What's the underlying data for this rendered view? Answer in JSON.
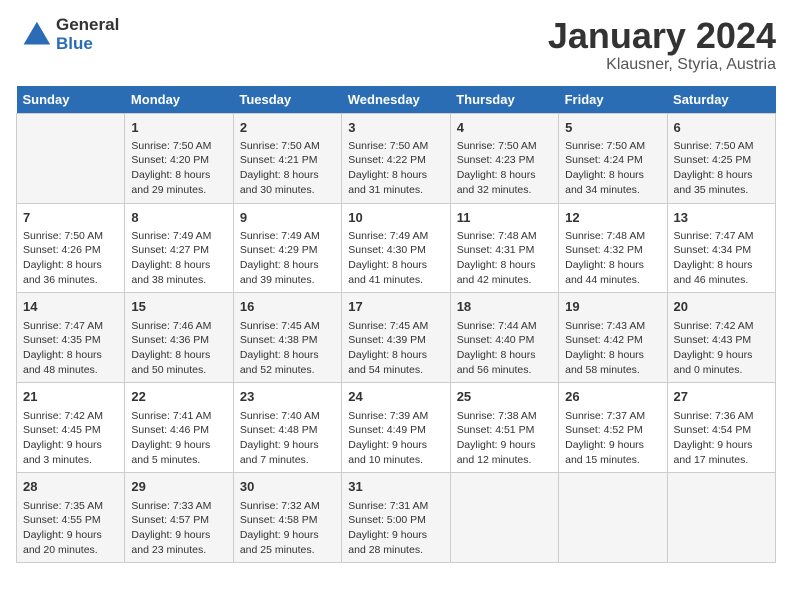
{
  "header": {
    "logo_general": "General",
    "logo_blue": "Blue",
    "month": "January 2024",
    "location": "Klausner, Styria, Austria"
  },
  "days_of_week": [
    "Sunday",
    "Monday",
    "Tuesday",
    "Wednesday",
    "Thursday",
    "Friday",
    "Saturday"
  ],
  "weeks": [
    [
      {
        "day": "",
        "info": ""
      },
      {
        "day": "1",
        "info": "Sunrise: 7:50 AM\nSunset: 4:20 PM\nDaylight: 8 hours\nand 29 minutes."
      },
      {
        "day": "2",
        "info": "Sunrise: 7:50 AM\nSunset: 4:21 PM\nDaylight: 8 hours\nand 30 minutes."
      },
      {
        "day": "3",
        "info": "Sunrise: 7:50 AM\nSunset: 4:22 PM\nDaylight: 8 hours\nand 31 minutes."
      },
      {
        "day": "4",
        "info": "Sunrise: 7:50 AM\nSunset: 4:23 PM\nDaylight: 8 hours\nand 32 minutes."
      },
      {
        "day": "5",
        "info": "Sunrise: 7:50 AM\nSunset: 4:24 PM\nDaylight: 8 hours\nand 34 minutes."
      },
      {
        "day": "6",
        "info": "Sunrise: 7:50 AM\nSunset: 4:25 PM\nDaylight: 8 hours\nand 35 minutes."
      }
    ],
    [
      {
        "day": "7",
        "info": "Sunrise: 7:50 AM\nSunset: 4:26 PM\nDaylight: 8 hours\nand 36 minutes."
      },
      {
        "day": "8",
        "info": "Sunrise: 7:49 AM\nSunset: 4:27 PM\nDaylight: 8 hours\nand 38 minutes."
      },
      {
        "day": "9",
        "info": "Sunrise: 7:49 AM\nSunset: 4:29 PM\nDaylight: 8 hours\nand 39 minutes."
      },
      {
        "day": "10",
        "info": "Sunrise: 7:49 AM\nSunset: 4:30 PM\nDaylight: 8 hours\nand 41 minutes."
      },
      {
        "day": "11",
        "info": "Sunrise: 7:48 AM\nSunset: 4:31 PM\nDaylight: 8 hours\nand 42 minutes."
      },
      {
        "day": "12",
        "info": "Sunrise: 7:48 AM\nSunset: 4:32 PM\nDaylight: 8 hours\nand 44 minutes."
      },
      {
        "day": "13",
        "info": "Sunrise: 7:47 AM\nSunset: 4:34 PM\nDaylight: 8 hours\nand 46 minutes."
      }
    ],
    [
      {
        "day": "14",
        "info": "Sunrise: 7:47 AM\nSunset: 4:35 PM\nDaylight: 8 hours\nand 48 minutes."
      },
      {
        "day": "15",
        "info": "Sunrise: 7:46 AM\nSunset: 4:36 PM\nDaylight: 8 hours\nand 50 minutes."
      },
      {
        "day": "16",
        "info": "Sunrise: 7:45 AM\nSunset: 4:38 PM\nDaylight: 8 hours\nand 52 minutes."
      },
      {
        "day": "17",
        "info": "Sunrise: 7:45 AM\nSunset: 4:39 PM\nDaylight: 8 hours\nand 54 minutes."
      },
      {
        "day": "18",
        "info": "Sunrise: 7:44 AM\nSunset: 4:40 PM\nDaylight: 8 hours\nand 56 minutes."
      },
      {
        "day": "19",
        "info": "Sunrise: 7:43 AM\nSunset: 4:42 PM\nDaylight: 8 hours\nand 58 minutes."
      },
      {
        "day": "20",
        "info": "Sunrise: 7:42 AM\nSunset: 4:43 PM\nDaylight: 9 hours\nand 0 minutes."
      }
    ],
    [
      {
        "day": "21",
        "info": "Sunrise: 7:42 AM\nSunset: 4:45 PM\nDaylight: 9 hours\nand 3 minutes."
      },
      {
        "day": "22",
        "info": "Sunrise: 7:41 AM\nSunset: 4:46 PM\nDaylight: 9 hours\nand 5 minutes."
      },
      {
        "day": "23",
        "info": "Sunrise: 7:40 AM\nSunset: 4:48 PM\nDaylight: 9 hours\nand 7 minutes."
      },
      {
        "day": "24",
        "info": "Sunrise: 7:39 AM\nSunset: 4:49 PM\nDaylight: 9 hours\nand 10 minutes."
      },
      {
        "day": "25",
        "info": "Sunrise: 7:38 AM\nSunset: 4:51 PM\nDaylight: 9 hours\nand 12 minutes."
      },
      {
        "day": "26",
        "info": "Sunrise: 7:37 AM\nSunset: 4:52 PM\nDaylight: 9 hours\nand 15 minutes."
      },
      {
        "day": "27",
        "info": "Sunrise: 7:36 AM\nSunset: 4:54 PM\nDaylight: 9 hours\nand 17 minutes."
      }
    ],
    [
      {
        "day": "28",
        "info": "Sunrise: 7:35 AM\nSunset: 4:55 PM\nDaylight: 9 hours\nand 20 minutes."
      },
      {
        "day": "29",
        "info": "Sunrise: 7:33 AM\nSunset: 4:57 PM\nDaylight: 9 hours\nand 23 minutes."
      },
      {
        "day": "30",
        "info": "Sunrise: 7:32 AM\nSunset: 4:58 PM\nDaylight: 9 hours\nand 25 minutes."
      },
      {
        "day": "31",
        "info": "Sunrise: 7:31 AM\nSunset: 5:00 PM\nDaylight: 9 hours\nand 28 minutes."
      },
      {
        "day": "",
        "info": ""
      },
      {
        "day": "",
        "info": ""
      },
      {
        "day": "",
        "info": ""
      }
    ]
  ]
}
